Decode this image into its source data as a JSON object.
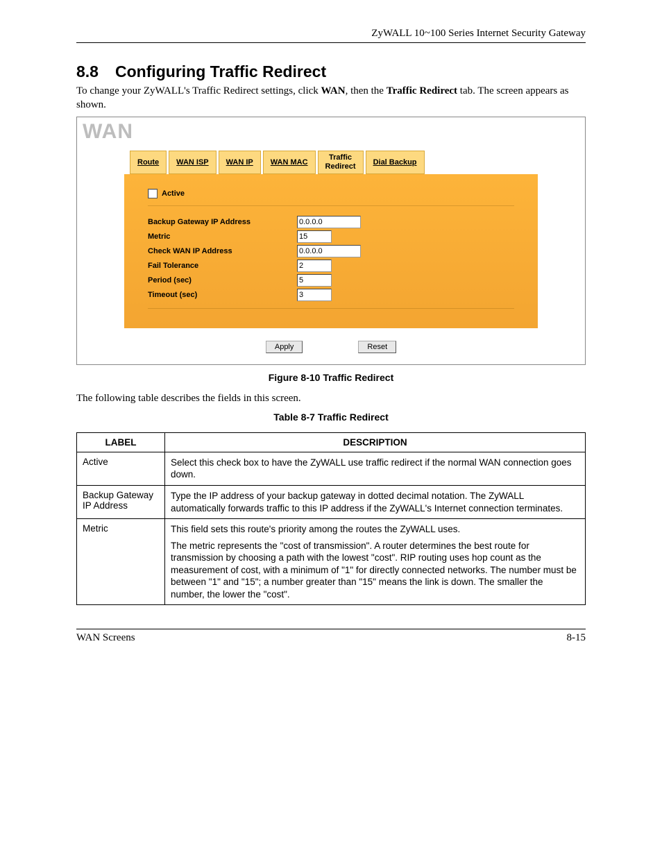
{
  "header": "ZyWALL 10~100 Series Internet Security Gateway",
  "section": {
    "number": "8.8",
    "title": "Configuring Traffic Redirect",
    "intro_before_wan": "To change your ZyWALL's Traffic Redirect settings, click ",
    "intro_wan": "WAN",
    "intro_mid": ", then the ",
    "intro_tr": "Traffic Redirect",
    "intro_after": " tab.  The screen appears as shown."
  },
  "shot": {
    "title": "WAN",
    "tabs": {
      "route": "Route",
      "wan_isp": "WAN ISP",
      "wan_ip": "WAN IP",
      "wan_mac": "WAN MAC",
      "traffic_redirect_l1": "Traffic",
      "traffic_redirect_l2": "Redirect",
      "dial_backup": "Dial Backup"
    },
    "form": {
      "active": "Active",
      "backup_gw": "Backup Gateway IP Address",
      "metric": "Metric",
      "check_wan": "Check WAN IP Address",
      "fail_tol": "Fail Tolerance",
      "period": "Period (sec)",
      "timeout": "Timeout (sec)",
      "vals": {
        "backup_gw": "0.0.0.0",
        "metric": "15",
        "check_wan": "0.0.0.0",
        "fail_tol": "2",
        "period": "5",
        "timeout": "3"
      }
    },
    "buttons": {
      "apply": "Apply",
      "reset": "Reset"
    }
  },
  "fig_caption": "Figure 8-10 Traffic Redirect",
  "following": "The following table describes the fields in this screen.",
  "tbl_caption": "Table 8-7 Traffic Redirect",
  "table": {
    "head_label": "LABEL",
    "head_desc": "DESCRIPTION",
    "rows": [
      {
        "label": "Active",
        "desc1": "Select this check box to have the ZyWALL use traffic redirect if the normal WAN connection goes down."
      },
      {
        "label": "Backup Gateway IP Address",
        "desc1": "Type the IP address of your backup gateway in dotted decimal notation. The ZyWALL automatically forwards traffic to this IP address if the ZyWALL's Internet connection terminates."
      },
      {
        "label": "Metric",
        "desc1": "This field sets this route's priority among the routes the ZyWALL uses.",
        "desc2": "The metric represents the \"cost of transmission\". A router determines the best route for transmission by choosing a path with the lowest \"cost\". RIP routing uses hop count as the measurement of cost, with a minimum of \"1\" for directly connected networks. The number must be between \"1\" and \"15\"; a number greater than \"15\" means the link is down. The smaller the number, the lower the \"cost\"."
      }
    ]
  },
  "footer": {
    "left": "WAN Screens",
    "right": "8-15"
  }
}
